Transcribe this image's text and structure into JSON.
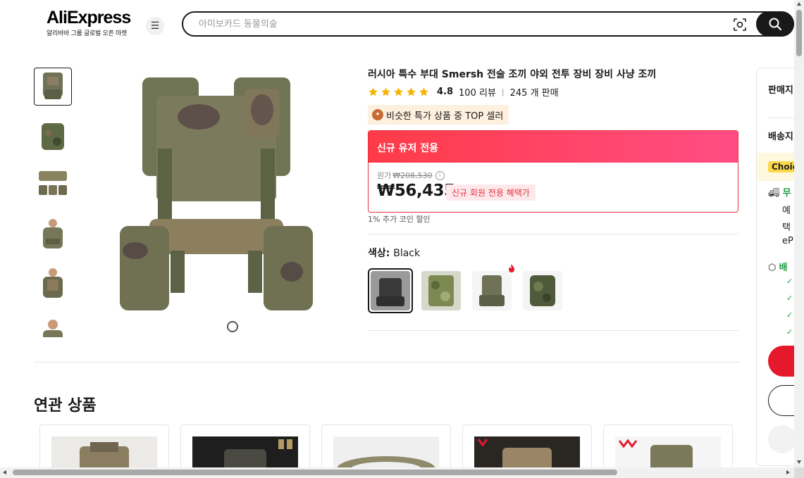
{
  "header": {
    "logo_text": "AliExpress",
    "logo_sub": "알리바바 그룹 글로벌 오픈 마켓",
    "search_placeholder": "아미보카드 동물의숲",
    "menu_icon": "hamburger-icon",
    "camera_icon": "camera-search-icon",
    "search_icon": "search-icon"
  },
  "gallery": {
    "thumbnail_count": 6,
    "active_index": 0
  },
  "product": {
    "title": "러시아 특수 부대 Smersh 전술 조끼 야외 전투 장비 장비 사냥 조끼",
    "rating": "4.8",
    "reviews": "100 리뷰",
    "sold": "245 개 판매",
    "star_count": 5,
    "badge": "비슷한 특가 상품 중 TOP 셀러",
    "deal_header": "신규 유저 전용",
    "original_label": "원가",
    "original_price": "₩208,530",
    "price": "₩56,435",
    "price_tag": "신규 회원 전용 혜택가",
    "coin_note": "1% 추가 코인 할인",
    "color_label": "색상: ",
    "color_value": "Black",
    "swatch_count": 4,
    "swatch_selected": 0
  },
  "side_panel": {
    "seller_title": "판매지",
    "ship_title": "배송지",
    "choice": "Choic",
    "free": "무",
    "row1": "예",
    "row2": "택",
    "row3": "eP",
    "ship_badge": "배",
    "check_icon": "check-icon"
  },
  "related": {
    "title": "연관 상품"
  },
  "colors": {
    "accent_red": "#e5192b",
    "deal_gradient_start": "#ff3b47",
    "deal_gradient_end": "#ff4d84",
    "star": "#f5b301",
    "choice": "#fbd849"
  }
}
